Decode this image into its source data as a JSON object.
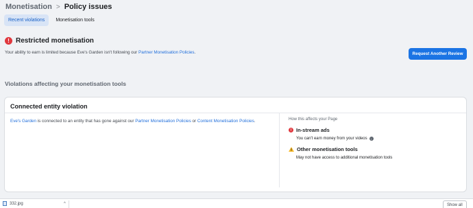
{
  "breadcrumb": {
    "parent": "Monetisation",
    "separator": ">",
    "current": "Policy issues"
  },
  "tabs": [
    {
      "label": "Recent violations",
      "active": true
    },
    {
      "label": "Monetisation tools",
      "active": false
    }
  ],
  "alert": {
    "icon": "!",
    "title": "Restricted monetisation",
    "body_prefix": "Your ability to earn is limited because Eve's Garden isn't following our ",
    "body_link": "Partner Monetisation Policies",
    "body_suffix": ".",
    "button_label": "Request Another Review"
  },
  "section_title": "Violations affecting your monetisation tools",
  "card": {
    "title": "Connected entity violation",
    "text_link1": "Eve's Garden",
    "text_mid1": " is connected to an entity that has gone against our ",
    "text_link2": "Partner Monetisation Policies",
    "text_mid2": " or ",
    "text_link3": "Content Monetisation Policies",
    "text_end": ".",
    "impact_heading": "How this affects your Page",
    "impacts": [
      {
        "icon": "!",
        "title": "In-stream ads",
        "desc": "You can't earn money from your videos",
        "info": "i"
      },
      {
        "title": "Other monetisation tools",
        "desc": "May not have access to additional monetisation tools"
      }
    ]
  },
  "footer": {
    "file_label": "332.jpg",
    "show_all": "Show all",
    "chevron": "^"
  },
  "colors": {
    "accent": "#1b74e4",
    "error": "#e0383e",
    "warning": "#f7b928"
  }
}
